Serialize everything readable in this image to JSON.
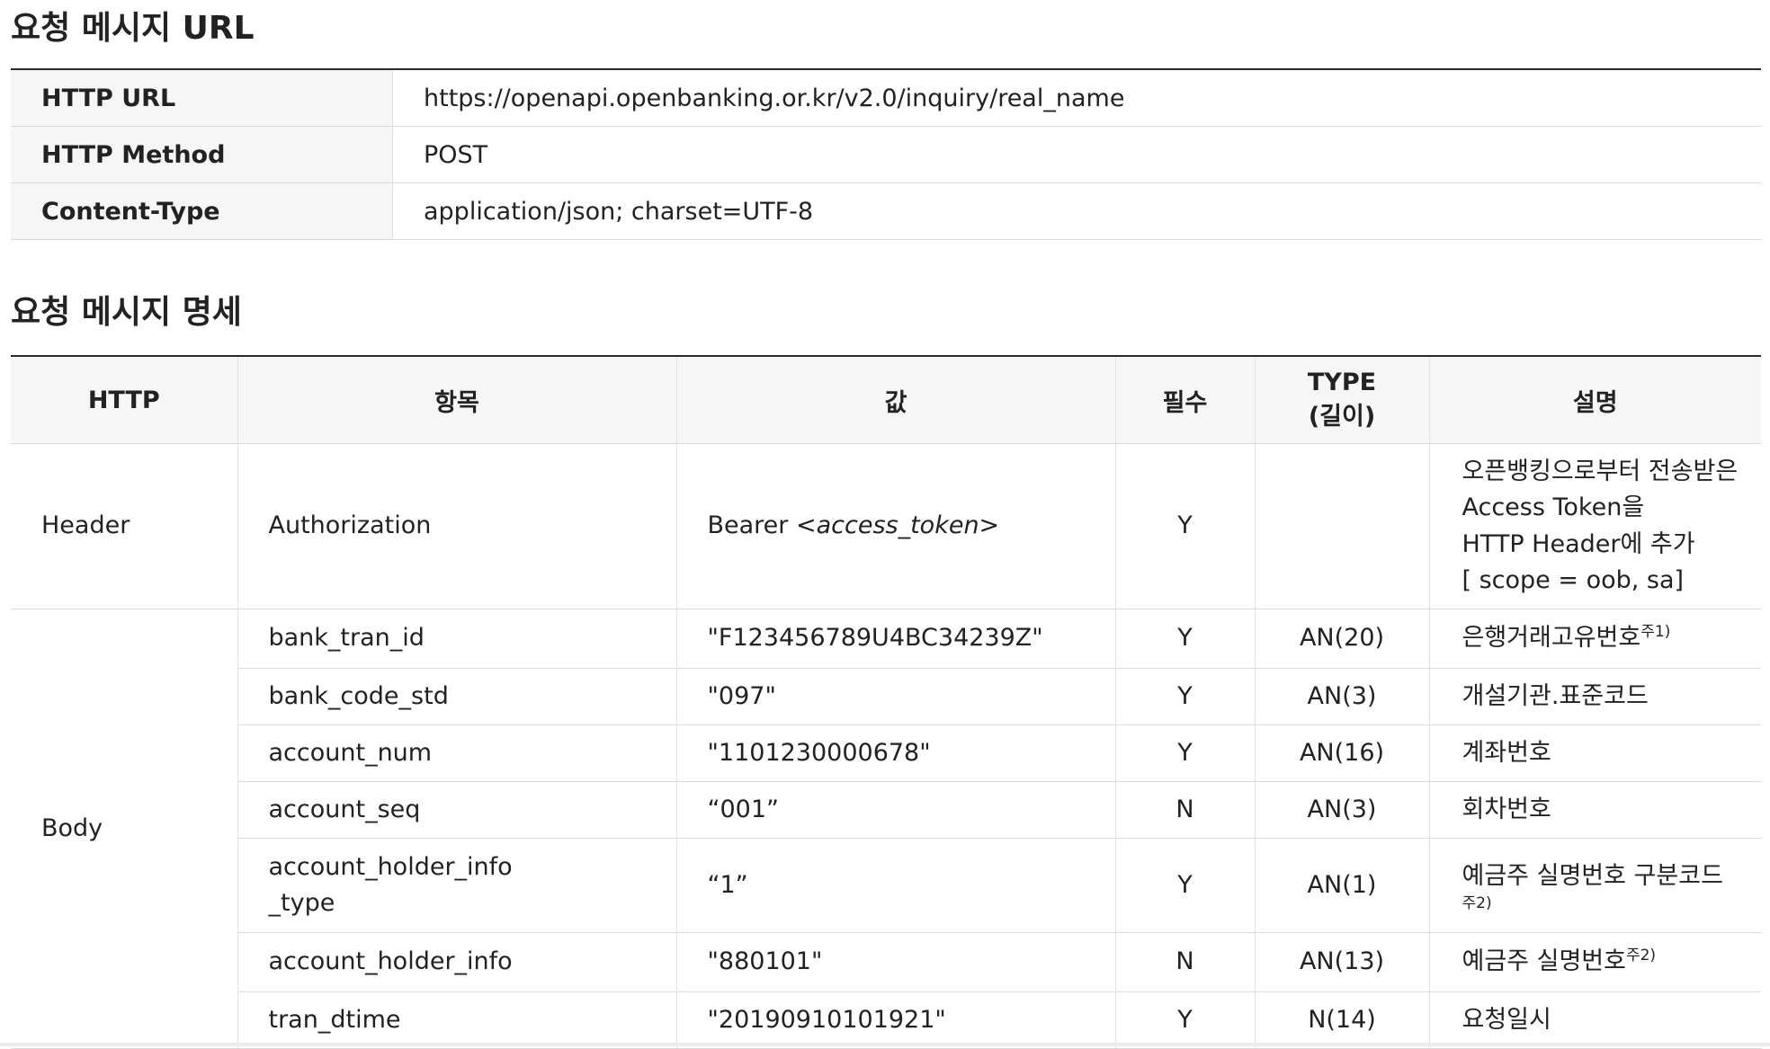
{
  "section1_title": "요청 메시지 URL",
  "url_table": [
    {
      "key": "HTTP URL",
      "value": "https://openapi.openbanking.or.kr/v2.0/inquiry/real_name"
    },
    {
      "key": "HTTP Method",
      "value": "POST"
    },
    {
      "key": "Content-Type",
      "value": "application/json; charset=UTF-8"
    }
  ],
  "section2_title": "요청 메시지 명세",
  "spec_headers": {
    "http": "HTTP",
    "item": "항목",
    "value": "값",
    "required": "필수",
    "type_line1": "TYPE",
    "type_line2": "(길이)",
    "description": "설명"
  },
  "groups": {
    "header": "Header",
    "body": "Body"
  },
  "rows": [
    {
      "item": "Authorization",
      "value_prefix": "Bearer ",
      "value_italic": "<access_token>",
      "required": "Y",
      "type": "",
      "desc_lines": [
        "오픈뱅킹으로부터 전송받은",
        "Access Token을",
        "HTTP Header에 추가",
        "[ scope = oob, sa]"
      ]
    },
    {
      "item": "bank_tran_id",
      "value": "\"F123456789U4BC34239Z\"",
      "required": "Y",
      "type": "AN(20)",
      "desc": "은행거래고유번호",
      "note": "주1)"
    },
    {
      "item": "bank_code_std",
      "value": "\"097\"",
      "required": "Y",
      "type": "AN(3)",
      "desc": "개설기관.표준코드"
    },
    {
      "item": "account_num",
      "value": "\"1101230000678\"",
      "required": "Y",
      "type": "AN(16)",
      "desc": "계좌번호"
    },
    {
      "item": "account_seq",
      "value": "“001”",
      "required": "N",
      "type": "AN(3)",
      "desc": "회차번호"
    },
    {
      "item_line1": "account_holder_info",
      "item_line2": "_type",
      "value": "“1”",
      "required": "Y",
      "type": "AN(1)",
      "desc": "예금주 실명번호 구분코드",
      "note": "주2)"
    },
    {
      "item": "account_holder_info",
      "value": "\"880101\"",
      "required": "N",
      "type": "AN(13)",
      "desc": "예금주 실명번호",
      "note": "주2)"
    },
    {
      "item": "tran_dtime",
      "value": "\"20190910101921\"",
      "required": "Y",
      "type": "N(14)",
      "desc": "요청일시"
    }
  ]
}
